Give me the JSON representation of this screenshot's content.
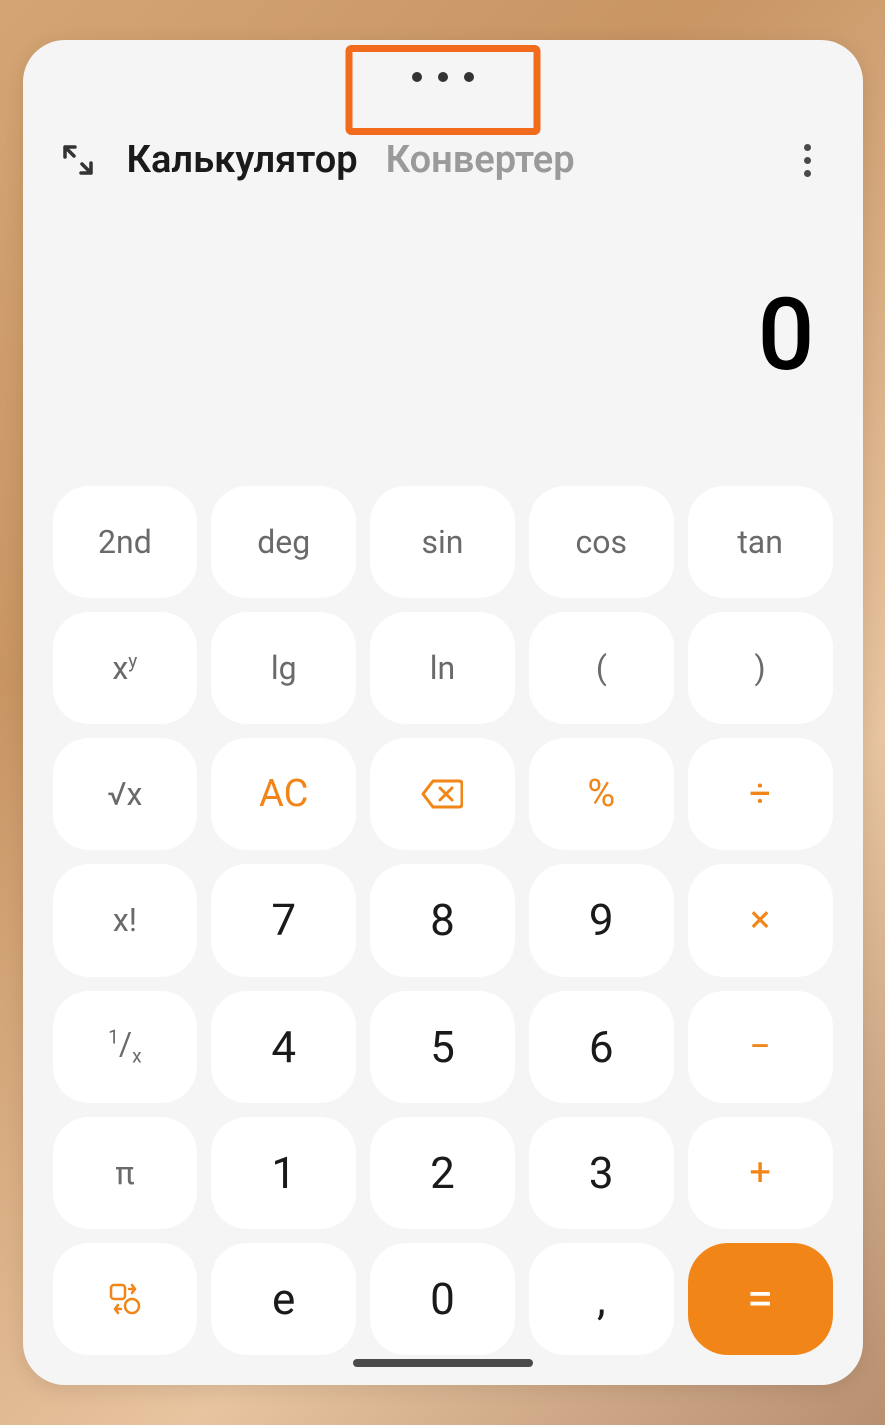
{
  "header": {
    "tab_calculator": "Калькулятор",
    "tab_converter": "Конвертер"
  },
  "display": {
    "value": "0"
  },
  "keys": {
    "second": "2nd",
    "deg": "deg",
    "sin": "sin",
    "cos": "cos",
    "tan": "tan",
    "xy_base": "x",
    "xy_exp": "y",
    "lg": "lg",
    "ln": "ln",
    "lparen": "(",
    "rparen": ")",
    "sqrt": "√x",
    "ac": "AC",
    "percent": "%",
    "divide": "÷",
    "factorial": "x!",
    "seven": "7",
    "eight": "8",
    "nine": "9",
    "multiply": "×",
    "inverse_num": "1",
    "inverse_den": "x",
    "four": "4",
    "five": "5",
    "six": "6",
    "minus": "−",
    "pi": "π",
    "one": "1",
    "two": "2",
    "three": "3",
    "plus": "+",
    "e": "e",
    "zero": "0",
    "comma": ",",
    "equals": "="
  },
  "colors": {
    "accent": "#f28518",
    "highlight": "#f26a1b"
  }
}
